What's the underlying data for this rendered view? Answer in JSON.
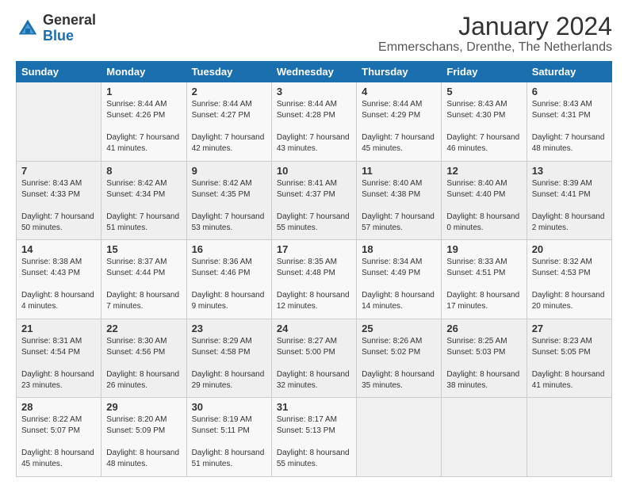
{
  "header": {
    "logo": {
      "general": "General",
      "blue": "Blue"
    },
    "title": "January 2024",
    "subtitle": "Emmerschans, Drenthe, The Netherlands"
  },
  "calendar": {
    "days_of_week": [
      "Sunday",
      "Monday",
      "Tuesday",
      "Wednesday",
      "Thursday",
      "Friday",
      "Saturday"
    ],
    "weeks": [
      [
        {
          "day": "",
          "info": ""
        },
        {
          "day": "1",
          "info": "Sunrise: 8:44 AM\nSunset: 4:26 PM\nDaylight: 7 hours\nand 41 minutes."
        },
        {
          "day": "2",
          "info": "Sunrise: 8:44 AM\nSunset: 4:27 PM\nDaylight: 7 hours\nand 42 minutes."
        },
        {
          "day": "3",
          "info": "Sunrise: 8:44 AM\nSunset: 4:28 PM\nDaylight: 7 hours\nand 43 minutes."
        },
        {
          "day": "4",
          "info": "Sunrise: 8:44 AM\nSunset: 4:29 PM\nDaylight: 7 hours\nand 45 minutes."
        },
        {
          "day": "5",
          "info": "Sunrise: 8:43 AM\nSunset: 4:30 PM\nDaylight: 7 hours\nand 46 minutes."
        },
        {
          "day": "6",
          "info": "Sunrise: 8:43 AM\nSunset: 4:31 PM\nDaylight: 7 hours\nand 48 minutes."
        }
      ],
      [
        {
          "day": "7",
          "info": "Sunrise: 8:43 AM\nSunset: 4:33 PM\nDaylight: 7 hours\nand 50 minutes."
        },
        {
          "day": "8",
          "info": "Sunrise: 8:42 AM\nSunset: 4:34 PM\nDaylight: 7 hours\nand 51 minutes."
        },
        {
          "day": "9",
          "info": "Sunrise: 8:42 AM\nSunset: 4:35 PM\nDaylight: 7 hours\nand 53 minutes."
        },
        {
          "day": "10",
          "info": "Sunrise: 8:41 AM\nSunset: 4:37 PM\nDaylight: 7 hours\nand 55 minutes."
        },
        {
          "day": "11",
          "info": "Sunrise: 8:40 AM\nSunset: 4:38 PM\nDaylight: 7 hours\nand 57 minutes."
        },
        {
          "day": "12",
          "info": "Sunrise: 8:40 AM\nSunset: 4:40 PM\nDaylight: 8 hours\nand 0 minutes."
        },
        {
          "day": "13",
          "info": "Sunrise: 8:39 AM\nSunset: 4:41 PM\nDaylight: 8 hours\nand 2 minutes."
        }
      ],
      [
        {
          "day": "14",
          "info": "Sunrise: 8:38 AM\nSunset: 4:43 PM\nDaylight: 8 hours\nand 4 minutes."
        },
        {
          "day": "15",
          "info": "Sunrise: 8:37 AM\nSunset: 4:44 PM\nDaylight: 8 hours\nand 7 minutes."
        },
        {
          "day": "16",
          "info": "Sunrise: 8:36 AM\nSunset: 4:46 PM\nDaylight: 8 hours\nand 9 minutes."
        },
        {
          "day": "17",
          "info": "Sunrise: 8:35 AM\nSunset: 4:48 PM\nDaylight: 8 hours\nand 12 minutes."
        },
        {
          "day": "18",
          "info": "Sunrise: 8:34 AM\nSunset: 4:49 PM\nDaylight: 8 hours\nand 14 minutes."
        },
        {
          "day": "19",
          "info": "Sunrise: 8:33 AM\nSunset: 4:51 PM\nDaylight: 8 hours\nand 17 minutes."
        },
        {
          "day": "20",
          "info": "Sunrise: 8:32 AM\nSunset: 4:53 PM\nDaylight: 8 hours\nand 20 minutes."
        }
      ],
      [
        {
          "day": "21",
          "info": "Sunrise: 8:31 AM\nSunset: 4:54 PM\nDaylight: 8 hours\nand 23 minutes."
        },
        {
          "day": "22",
          "info": "Sunrise: 8:30 AM\nSunset: 4:56 PM\nDaylight: 8 hours\nand 26 minutes."
        },
        {
          "day": "23",
          "info": "Sunrise: 8:29 AM\nSunset: 4:58 PM\nDaylight: 8 hours\nand 29 minutes."
        },
        {
          "day": "24",
          "info": "Sunrise: 8:27 AM\nSunset: 5:00 PM\nDaylight: 8 hours\nand 32 minutes."
        },
        {
          "day": "25",
          "info": "Sunrise: 8:26 AM\nSunset: 5:02 PM\nDaylight: 8 hours\nand 35 minutes."
        },
        {
          "day": "26",
          "info": "Sunrise: 8:25 AM\nSunset: 5:03 PM\nDaylight: 8 hours\nand 38 minutes."
        },
        {
          "day": "27",
          "info": "Sunrise: 8:23 AM\nSunset: 5:05 PM\nDaylight: 8 hours\nand 41 minutes."
        }
      ],
      [
        {
          "day": "28",
          "info": "Sunrise: 8:22 AM\nSunset: 5:07 PM\nDaylight: 8 hours\nand 45 minutes."
        },
        {
          "day": "29",
          "info": "Sunrise: 8:20 AM\nSunset: 5:09 PM\nDaylight: 8 hours\nand 48 minutes."
        },
        {
          "day": "30",
          "info": "Sunrise: 8:19 AM\nSunset: 5:11 PM\nDaylight: 8 hours\nand 51 minutes."
        },
        {
          "day": "31",
          "info": "Sunrise: 8:17 AM\nSunset: 5:13 PM\nDaylight: 8 hours\nand 55 minutes."
        },
        {
          "day": "",
          "info": ""
        },
        {
          "day": "",
          "info": ""
        },
        {
          "day": "",
          "info": ""
        }
      ]
    ]
  }
}
